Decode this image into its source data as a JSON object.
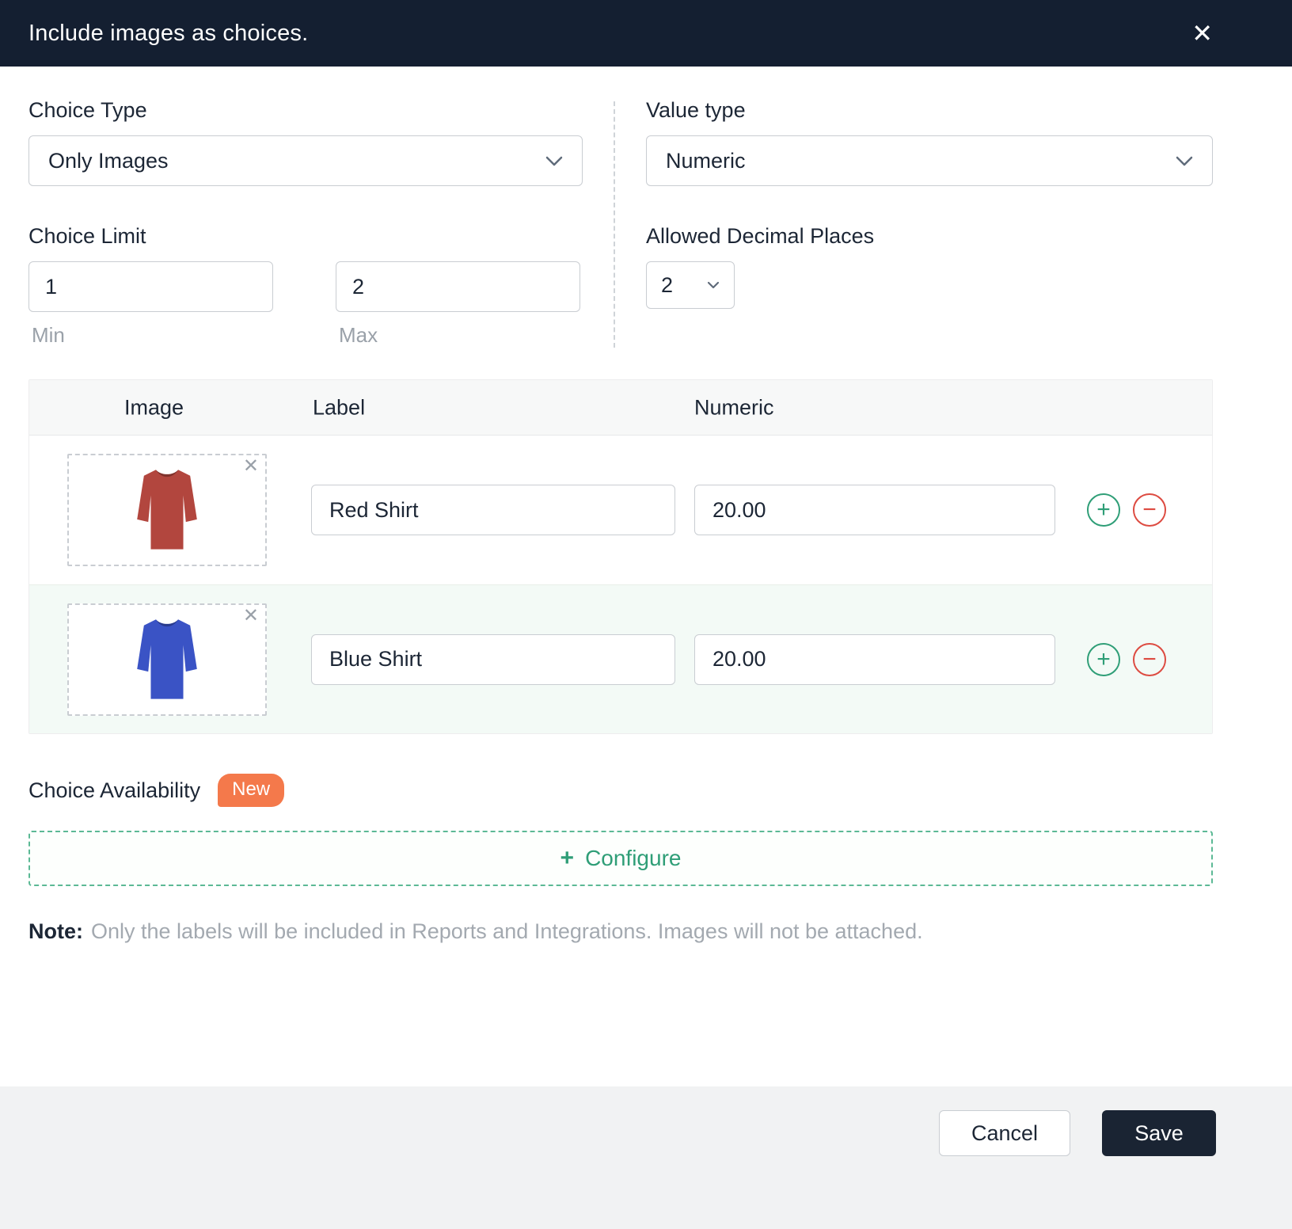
{
  "header": {
    "title": "Include images as choices."
  },
  "icons": {
    "close": "✕",
    "remove": "✕",
    "plus": "+",
    "minus": "−",
    "configure_plus": "+"
  },
  "form": {
    "choice_type": {
      "label": "Choice Type",
      "value": "Only Images"
    },
    "value_type": {
      "label": "Value type",
      "value": "Numeric"
    },
    "choice_limit": {
      "label": "Choice Limit",
      "min": {
        "value": "1",
        "caption": "Min"
      },
      "max": {
        "value": "2",
        "caption": "Max"
      }
    },
    "decimal_places": {
      "label": "Allowed Decimal Places",
      "value": "2"
    }
  },
  "table": {
    "headers": {
      "image": "Image",
      "label": "Label",
      "numeric": "Numeric"
    },
    "rows": [
      {
        "image_name": "red-shirt",
        "shirt_color": "#b2463e",
        "label": "Red Shirt",
        "numeric": "20.00"
      },
      {
        "image_name": "blue-shirt",
        "shirt_color": "#3a53c5",
        "label": "Blue Shirt",
        "numeric": "20.00"
      }
    ]
  },
  "availability": {
    "label": "Choice Availability",
    "badge": "New"
  },
  "configure": {
    "label": "Configure"
  },
  "note": {
    "prefix": "Note:",
    "text": "Only the labels will be included in Reports and Integrations. Images will not be attached."
  },
  "footer": {
    "cancel": "Cancel",
    "save": "Save"
  },
  "colors": {
    "header_bg": "#141f31",
    "accent_green": "#2f9e77",
    "badge_orange": "#f4794b",
    "row_alt": "#f3faf6",
    "danger": "#dd4b41",
    "save_bg": "#1a2433"
  }
}
